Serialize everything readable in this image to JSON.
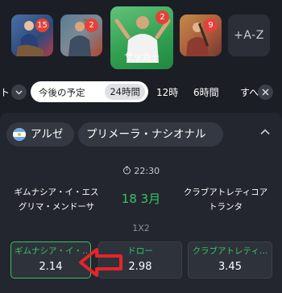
{
  "sports": {
    "tiles": [
      {
        "name": "sport-tile-1",
        "badge": "15"
      },
      {
        "name": "sport-tile-2",
        "badge": "2"
      },
      {
        "name": "sport-tile-soccer",
        "badge": "2",
        "label": "サッカー"
      },
      {
        "name": "sport-tile-4",
        "badge": "9"
      }
    ],
    "az_label": "+A-Z"
  },
  "filters": {
    "truncated_left": "ト",
    "dropdown_icon": "chevron-down-icon",
    "upcoming": "今後の予定",
    "selected": "24時間",
    "option_12h": "12時",
    "option_6h": "6時間",
    "truncated_right": "すへ",
    "close_icon": "close-icon"
  },
  "league": {
    "country": "アルゼ",
    "name": "プリメーラ・ナシオナル",
    "flag_icon": "argentina-flag-icon"
  },
  "match": {
    "time": "22:30",
    "home_line1": "ギムナシア・イ・エス",
    "home_line2": "グリマ・メンドーサ",
    "date": "18 3月",
    "away_line1": "クラブアトレティコア",
    "away_line2": "トランタ",
    "market": "1X2"
  },
  "odds": [
    {
      "label": "ギムナシア・イ・…",
      "value": "2.14"
    },
    {
      "label": "ドロー",
      "value": "2.98"
    },
    {
      "label": "クラブアトレティ…",
      "value": "3.45"
    }
  ],
  "colors": {
    "background": "#1b1e25",
    "card": "#23262e",
    "accent_green": "#36c464",
    "badge_red": "#e2423a",
    "annotation_red": "#e8232a"
  }
}
